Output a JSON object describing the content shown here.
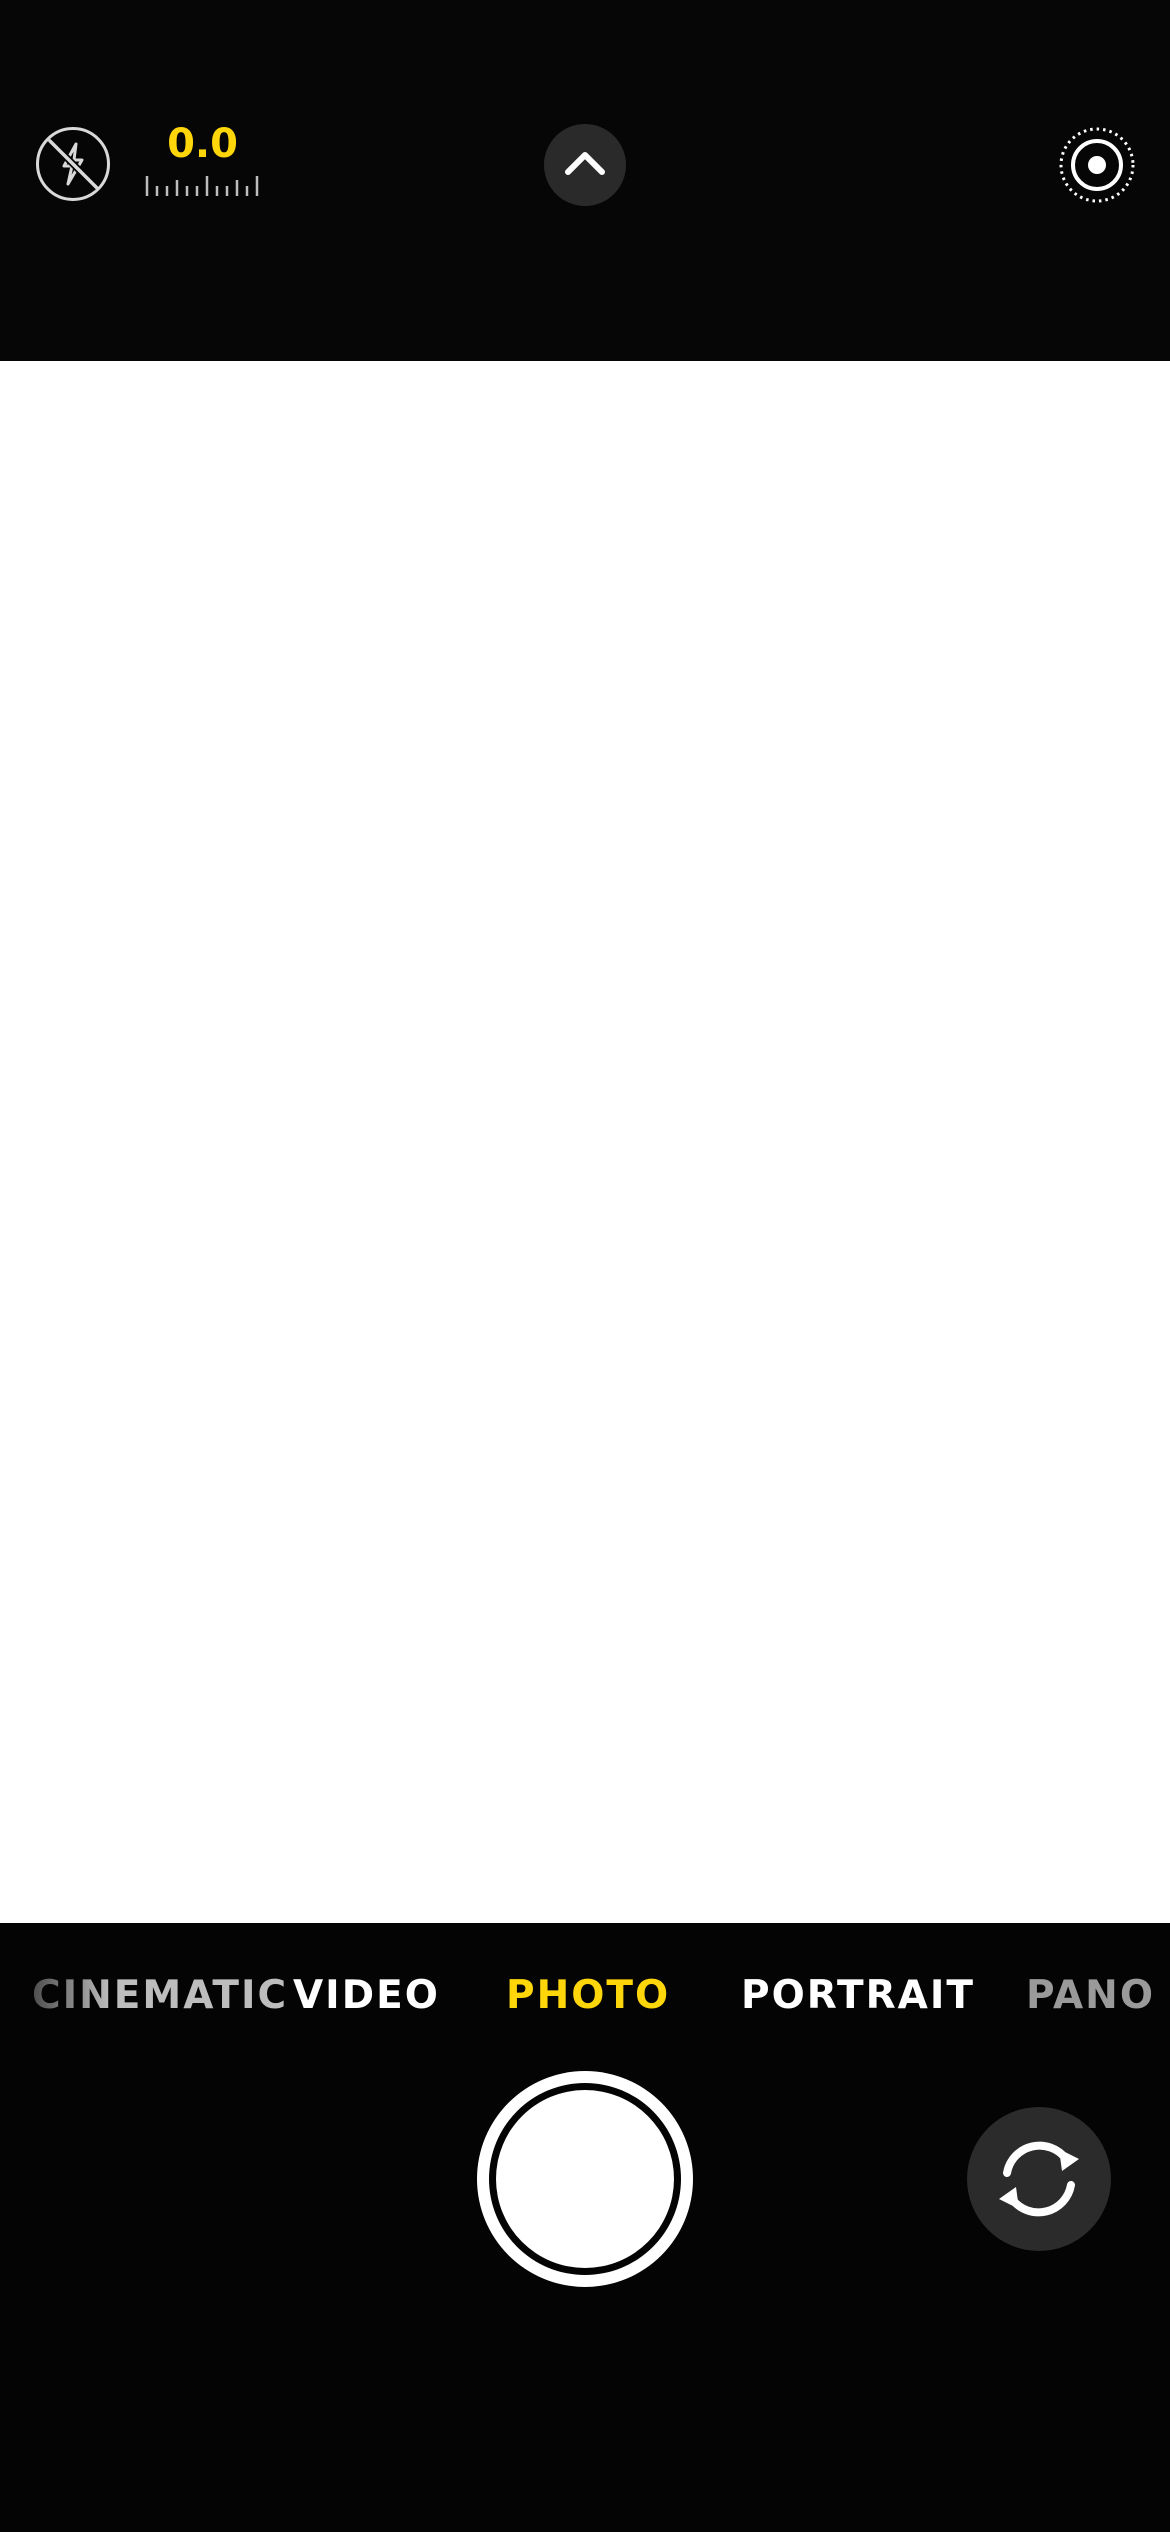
{
  "top_controls": {
    "flash": {
      "icon": "flash-off-icon",
      "state": "off"
    },
    "exposure": {
      "value": "0.0",
      "color": "#ffd60a"
    },
    "expand": {
      "icon": "chevron-up-icon"
    },
    "live_photo": {
      "icon": "live-photo-icon",
      "state": "on"
    }
  },
  "modes": {
    "items": [
      "CINEMATIC",
      "VIDEO",
      "PHOTO",
      "PORTRAIT",
      "PANO"
    ],
    "selected": "PHOTO",
    "selected_color": "#ffd60a"
  },
  "bottom_controls": {
    "shutter": {
      "icon": "shutter-icon"
    },
    "flip_camera": {
      "icon": "camera-flip-icon"
    }
  },
  "viewfinder": {
    "background": "#ffffff"
  }
}
